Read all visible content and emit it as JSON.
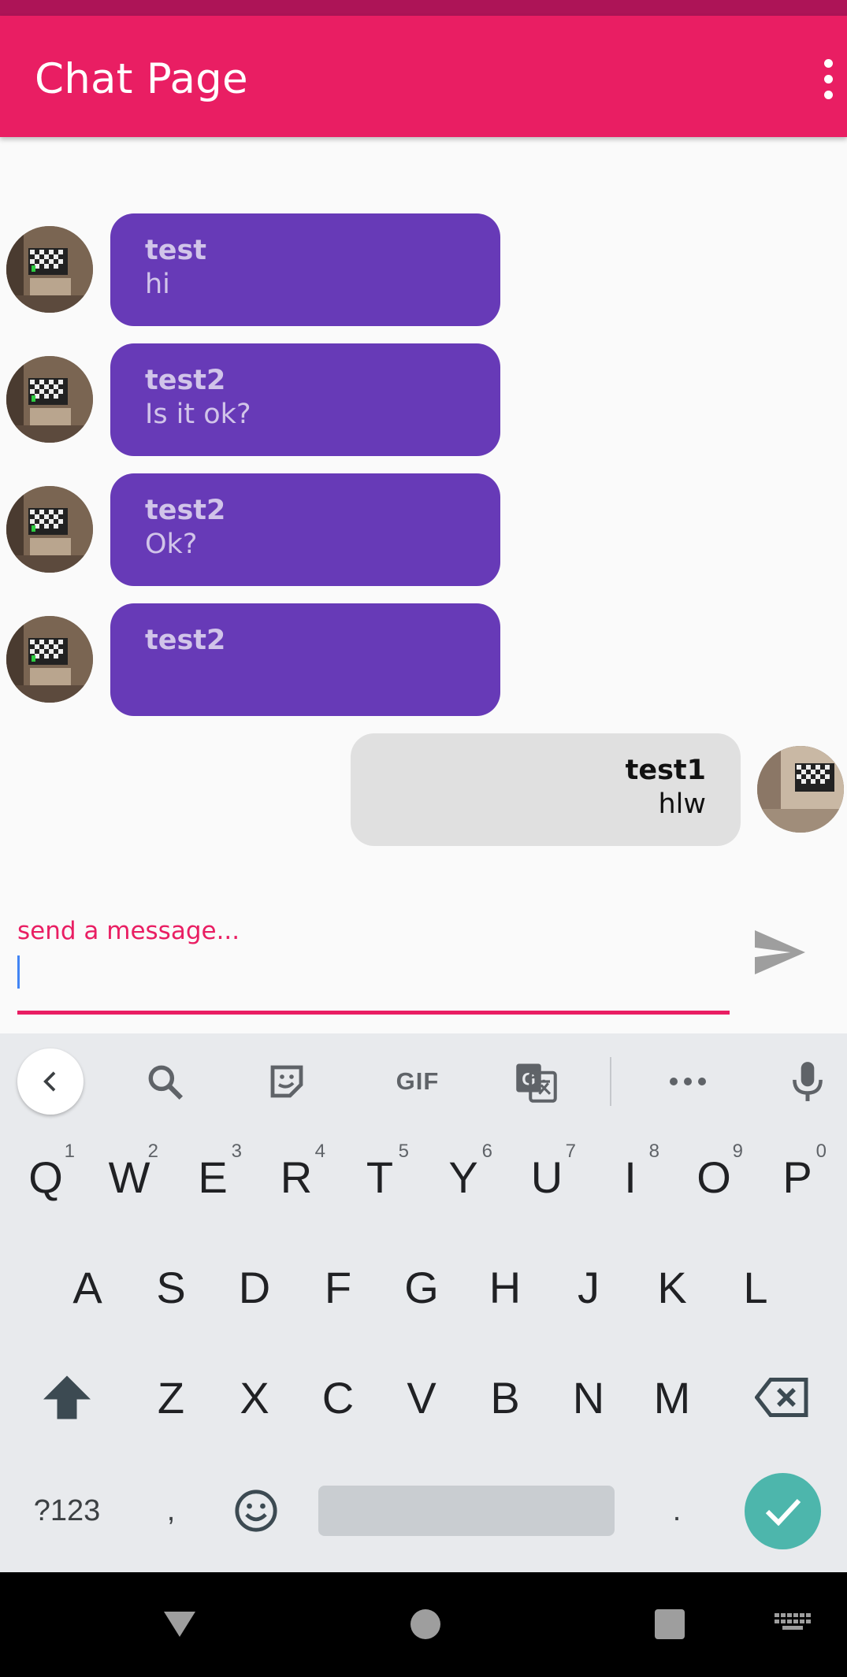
{
  "app_bar": {
    "title": "Chat Page",
    "menu_icon": "more-vert-icon"
  },
  "colors": {
    "primary": "#e91e63",
    "primary_dark": "#ad1457",
    "incoming_bubble": "#673ab7",
    "outgoing_bubble": "#e0e0e0",
    "accent_cursor": "#4285f4",
    "enter_key": "#4db6ac"
  },
  "messages": [
    {
      "sender": "test",
      "text": "hi",
      "direction": "incoming"
    },
    {
      "sender": "test2",
      "text": "Is it ok?",
      "direction": "incoming"
    },
    {
      "sender": "test2",
      "text": "Ok?",
      "direction": "incoming"
    },
    {
      "sender": "test2",
      "text": "",
      "direction": "incoming"
    },
    {
      "sender": "test1",
      "text": "hlw",
      "direction": "outgoing"
    }
  ],
  "composer": {
    "label": "send a message...",
    "value": "",
    "send_icon": "send-icon"
  },
  "keyboard": {
    "toolbar": {
      "back_icon": "chevron-left-icon",
      "search_icon": "search-icon",
      "sticker_icon": "sticker-icon",
      "gif_label": "GIF",
      "translate_icon": "translate-icon",
      "more_icon": "more-horiz-icon",
      "mic_icon": "mic-icon"
    },
    "row1": [
      {
        "key": "Q",
        "hint": "1"
      },
      {
        "key": "W",
        "hint": "2"
      },
      {
        "key": "E",
        "hint": "3"
      },
      {
        "key": "R",
        "hint": "4"
      },
      {
        "key": "T",
        "hint": "5"
      },
      {
        "key": "Y",
        "hint": "6"
      },
      {
        "key": "U",
        "hint": "7"
      },
      {
        "key": "I",
        "hint": "8"
      },
      {
        "key": "O",
        "hint": "9"
      },
      {
        "key": "P",
        "hint": "0"
      }
    ],
    "row2": [
      "A",
      "S",
      "D",
      "F",
      "G",
      "H",
      "J",
      "K",
      "L"
    ],
    "row3": [
      "Z",
      "X",
      "C",
      "V",
      "B",
      "N",
      "M"
    ],
    "bottom": {
      "symbols": "?123",
      "comma": ",",
      "period": "."
    }
  },
  "nav_bar": {
    "back_icon": "nav-back-icon",
    "home_icon": "nav-home-icon",
    "recents_icon": "nav-recents-icon",
    "keyboard_icon": "keyboard-icon"
  }
}
